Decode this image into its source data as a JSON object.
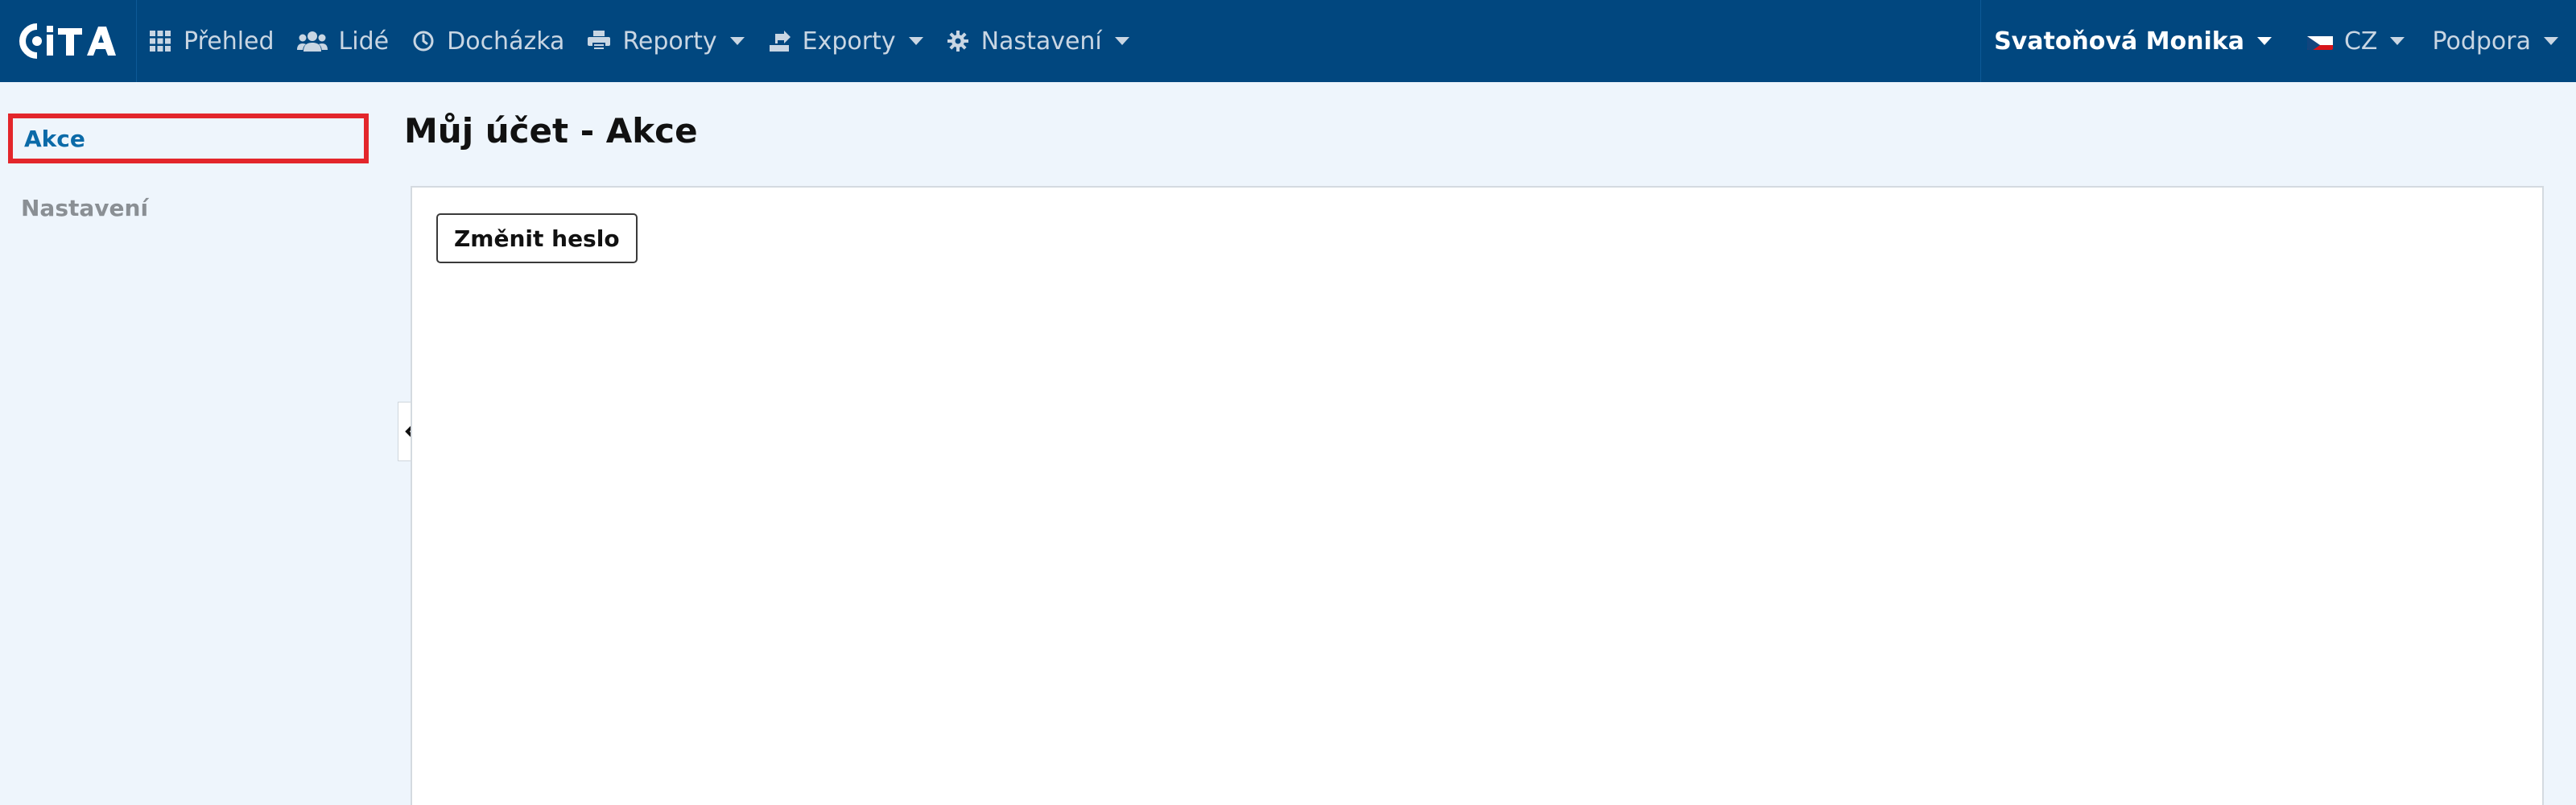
{
  "app": {
    "logo_text": "CiTA"
  },
  "navbar": {
    "items": [
      {
        "label": "Přehled",
        "icon": "grid-icon"
      },
      {
        "label": "Lidé",
        "icon": "users-icon"
      },
      {
        "label": "Docházka",
        "icon": "clock-icon"
      },
      {
        "label": "Reporty",
        "icon": "printer-icon",
        "dropdown": true
      },
      {
        "label": "Exporty",
        "icon": "export-icon",
        "dropdown": true
      },
      {
        "label": "Nastavení",
        "icon": "gear-icon",
        "dropdown": true
      }
    ],
    "user_name": "Svatoňová Monika",
    "language": "CZ",
    "support": "Podpora"
  },
  "sidebar": {
    "items": [
      {
        "label": "Akce",
        "active": true
      },
      {
        "label": "Nastavení",
        "active": false
      }
    ]
  },
  "main": {
    "title": "Můj účet - Akce",
    "change_password_label": "Změnit heslo"
  },
  "colors": {
    "navbar_bg": "#01477f",
    "page_bg": "#eef5fc",
    "active_link": "#0b6aa8",
    "highlight_border": "#e3262b"
  }
}
